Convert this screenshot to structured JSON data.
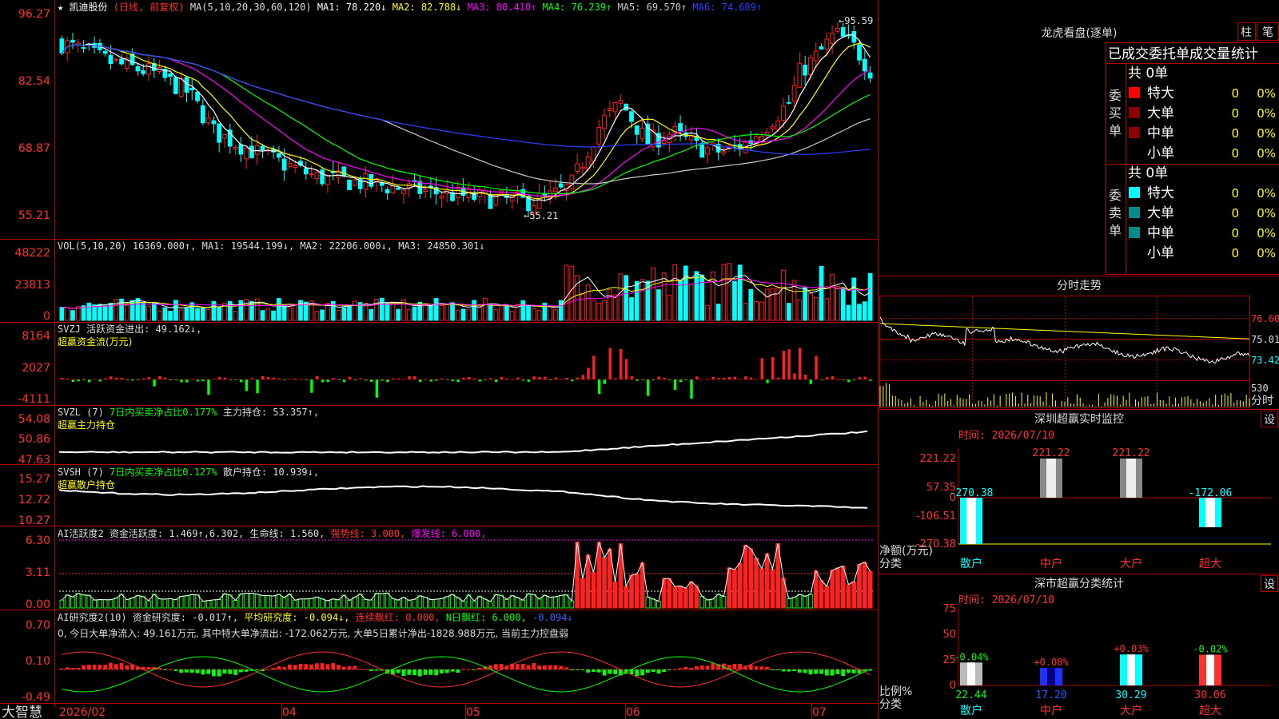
{
  "app_name": "大智慧",
  "stock": {
    "name": "凯迪股份",
    "period": "(日线, 前复权)"
  },
  "price_panel": {
    "header": {
      "ma_params": "MA(5,10,20,30,60,120)",
      "items": [
        {
          "label": "MA1: 78.220↓",
          "color": "#ffffff"
        },
        {
          "label": "MA2: 82.788↓",
          "color": "#ffff00"
        },
        {
          "label": "MA3: 80.410↑",
          "color": "#ff00ff"
        },
        {
          "label": "MA4: 76.239↑",
          "color": "#00ff00"
        },
        {
          "label": "MA5: 69.570↑",
          "color": "#c8c8c8"
        },
        {
          "label": "MA6: 74.689↑",
          "color": "#2f3fff"
        }
      ]
    },
    "y_ticks": [
      "96.27",
      "82.54",
      "68.87",
      "55.21"
    ],
    "high_label": "95.59",
    "low_label": "55.21"
  },
  "volume_panel": {
    "header": "VOL(5,10,20) 16369.000↑, MA1: 19544.199↓, MA2: 22206.000↓, MA3: 24850.301↓",
    "y_ticks": [
      "48222",
      "23813",
      "0"
    ]
  },
  "svzj_panel": {
    "line1": "SVZJ  活跃资金进出: 49.162↓,",
    "line2": "超赢资金流(万元)",
    "y_ticks": [
      "8164",
      "2027",
      "-4111"
    ]
  },
  "svzl_panel": {
    "line1_a": "SVZL (7)",
    "line1_b": "7日内买卖净占比0.177%",
    "line1_c": "主力持仓: 53.357↑,",
    "line2": "超赢主力持仓",
    "y_ticks": [
      "54.08",
      "50.86",
      "47.63"
    ]
  },
  "svsh_panel": {
    "line1_a": "SVSH (7)",
    "line1_b": "7日内买卖净占比0.127%",
    "line1_c": "散户持仓: 10.939↓,",
    "line2": "超赢散户持仓",
    "y_ticks": [
      "15.27",
      "12.72",
      "10.27"
    ]
  },
  "ai_active_panel": {
    "a": "AI活跃度2 资金活跃度: 1.469↑,6.302,",
    "b": "生命线: 1.560,",
    "c": "强势线: 3.000,",
    "d": "爆发线: 6.000,",
    "y_ticks": [
      "6.30",
      "3.11",
      "0.00"
    ]
  },
  "ai_research_panel": {
    "a": "AI研究度2(10) 资金研究度: -0.017↑,",
    "b": "平均研究度: -0.094↓,",
    "c": "连续飘红: 0.000,",
    "d": "N日飘红: 6.000,",
    "e": "-0.094↓",
    "line2": "0, 今日大单净流入: 49.161万元, 其中特大单净流出: -172.062万元, 大单5日累计净出-1828.988万元, 当前主力控盘弱",
    "y_ticks": [
      "0.70",
      "0.10",
      "-0.49"
    ]
  },
  "x_axis": {
    "labels": [
      "2026/02",
      "04",
      "05",
      "06",
      "07"
    ]
  },
  "dragon_tiger": {
    "title": "龙虎看盘(逐单)",
    "btn_column": "柱",
    "btn_pen": "笔",
    "tabs": [
      "已成交",
      "委托单",
      "成交量",
      "统计"
    ],
    "buy_label": "委买单",
    "sell_label": "委卖单",
    "buy_total": "共 0单",
    "sell_total": "共 0单",
    "rows": [
      {
        "name": "特大",
        "count": "0",
        "pct": "0%"
      },
      {
        "name": "大单",
        "count": "0",
        "pct": "0%"
      },
      {
        "name": "中单",
        "count": "0",
        "pct": "0%"
      },
      {
        "name": "小单",
        "count": "0",
        "pct": "0%"
      }
    ],
    "buy_colors": [
      "#ff0000",
      "#8b0000",
      "#8b0000",
      ""
    ],
    "sell_colors": [
      "#00ffff",
      "#008b8b",
      "#008b8b",
      ""
    ]
  },
  "timeshare": {
    "title": "分时走势",
    "y_labels": [
      "76.60",
      "75.01",
      "73.42"
    ],
    "vol_label": "530",
    "footer_label": "分时"
  },
  "realtime_monitor": {
    "title": "深圳超赢实时监控",
    "settings_label": "设",
    "time": "时间: 2026/07/10",
    "y_ticks": [
      "221.22",
      "57.35",
      "0",
      "-106.51",
      "-270.38"
    ],
    "y_caption_1": "净额(万元)",
    "y_caption_2": "分类",
    "categories": [
      "散户",
      "中户",
      "大户",
      "超大"
    ],
    "values": [
      -270.38,
      221.22,
      221.22,
      -172.06
    ],
    "value_labels": [
      "-270.38",
      "221.22",
      "221.22",
      "-172.06"
    ]
  },
  "category_stats": {
    "title": "深市超赢分类统计",
    "settings_label": "设",
    "time": "时间: 2026/07/10",
    "y_ticks": [
      "75",
      "50",
      "25",
      "0"
    ],
    "y_caption_1": "比例%",
    "y_caption_2": "分类",
    "categories": [
      "散户",
      "中户",
      "大户",
      "超大"
    ],
    "ratios": [
      22.44,
      17.2,
      30.29,
      30.06
    ],
    "ratio_labels": [
      "22.44",
      "17.20",
      "30.29",
      "30.06"
    ],
    "change_labels": [
      "-0.04%",
      "+0.08%",
      "+0.03%",
      "-0.02%"
    ]
  },
  "colors": {
    "up": "#ff2020",
    "down": "#00ffff",
    "frame": "#b00000",
    "yellow": "#ffff00",
    "green": "#00ff00"
  }
}
